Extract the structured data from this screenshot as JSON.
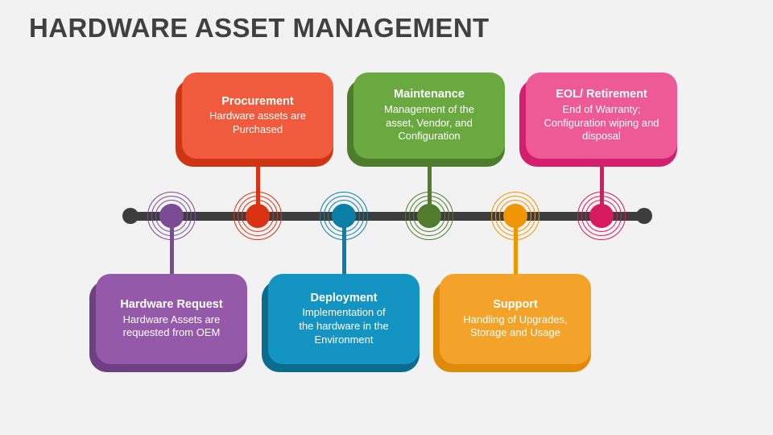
{
  "slide": {
    "title": "HARDWARE ASSET MANAGEMENT",
    "background_color": "#f2f2f2",
    "title_color": "#404040"
  },
  "timeline": {
    "axis_color": "#3d3d3d",
    "endpoint_left_label": "timeline-start-dot",
    "endpoint_right_label": "timeline-end-dot"
  },
  "stages": [
    {
      "id": "hardware-request",
      "title": "Hardware Request",
      "description": "Hardware Assets are\nrequested from OEM",
      "color": "#9459a8",
      "plate_color": "#6e3f82",
      "position": "bottom",
      "order": 1
    },
    {
      "id": "procurement",
      "title": "Procurement",
      "description": "Hardware assets are\nPurchased",
      "color": "#ef5b3c",
      "plate_color": "#cf3512",
      "position": "top",
      "order": 2
    },
    {
      "id": "deployment",
      "title": "Deployment",
      "description": "Implementation of\nthe hardware in the\nEnvironment",
      "color": "#1394c2",
      "plate_color": "#0a6d90",
      "position": "bottom",
      "order": 3
    },
    {
      "id": "maintenance",
      "title": "Maintenance",
      "description": "Management of the\nasset, Vendor, and\nConfiguration",
      "color": "#6aa940",
      "plate_color": "#4d7c2c",
      "position": "top",
      "order": 4
    },
    {
      "id": "support",
      "title": "Support",
      "description": "Handling of Upgrades,\nStorage and Usage",
      "color": "#f3a32a",
      "plate_color": "#e08a0a",
      "position": "bottom",
      "order": 5
    },
    {
      "id": "eol-retirement",
      "title": "EOL/ Retirement",
      "description": "End of Warranty;\nConfiguration wiping and\ndisposal",
      "color": "#ed5a95",
      "plate_color": "#d41f6e",
      "position": "top",
      "order": 6
    }
  ],
  "markers": [
    {
      "id": "marker-hardware-request",
      "color": "#7c4b96"
    },
    {
      "id": "marker-procurement",
      "color": "#d93314"
    },
    {
      "id": "marker-deployment",
      "color": "#0b7fa8"
    },
    {
      "id": "marker-maintenance",
      "color": "#507c2c"
    },
    {
      "id": "marker-support",
      "color": "#ef9500"
    },
    {
      "id": "marker-eol-retirement",
      "color": "#d81b60"
    }
  ]
}
